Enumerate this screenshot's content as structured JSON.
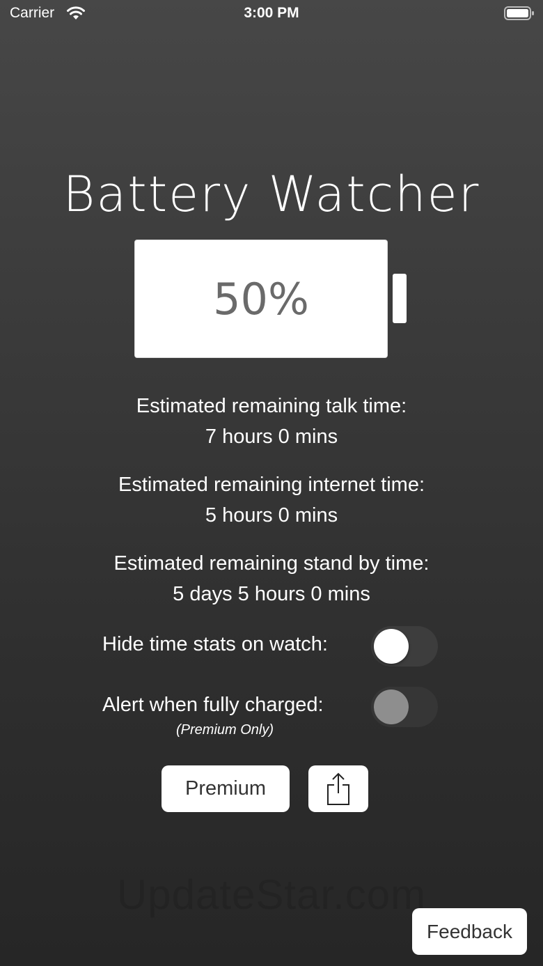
{
  "status_bar": {
    "carrier": "Carrier",
    "time": "3:00 PM"
  },
  "app": {
    "title": "Battery Watcher"
  },
  "battery": {
    "percent_label": "50%",
    "level": 0.5
  },
  "stats": {
    "talk_label": "Estimated remaining talk time:",
    "talk_value": "7 hours 0 mins",
    "internet_label": "Estimated remaining internet time:",
    "internet_value": "5 hours 0 mins",
    "standby_label": "Estimated remaining stand by time:",
    "standby_value": "5 days 5 hours 0 mins"
  },
  "settings": {
    "hide_stats_label": "Hide time stats on watch:",
    "hide_stats_on": false,
    "alert_label": "Alert when fully charged:",
    "alert_note": "(Premium Only)",
    "alert_on": false
  },
  "buttons": {
    "premium": "Premium",
    "feedback": "Feedback"
  },
  "icons": {
    "share": "share-icon",
    "wifi": "wifi-icon",
    "battery": "battery-icon"
  },
  "watermark": "UpdateStar.com",
  "colors": {
    "background": "#3a3a3a",
    "text": "#ffffff",
    "battery_text": "#6a6a6a"
  }
}
